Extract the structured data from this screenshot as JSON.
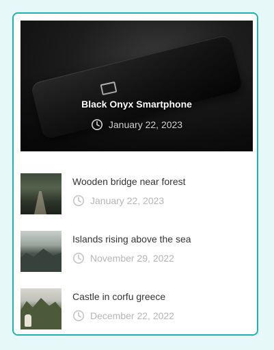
{
  "featured": {
    "title": "Black Onyx Smartphone",
    "date": "January 22, 2023",
    "image_icon": "smartphone-photo"
  },
  "posts": [
    {
      "title": "Wooden bridge near forest",
      "date": "January 22, 2023",
      "image_icon": "forest-bridge-photo"
    },
    {
      "title": "Islands rising above the sea",
      "date": "November 29, 2022",
      "image_icon": "islands-photo"
    },
    {
      "title": "Castle in corfu greece",
      "date": "December 22, 2022",
      "image_icon": "castle-photo"
    }
  ],
  "icons": {
    "date": "clock-icon"
  },
  "colors": {
    "page_background": "#e6f8f8",
    "card_border": "#1fb2b2",
    "post_title": "#333333",
    "post_date": "#b5b5b5"
  }
}
